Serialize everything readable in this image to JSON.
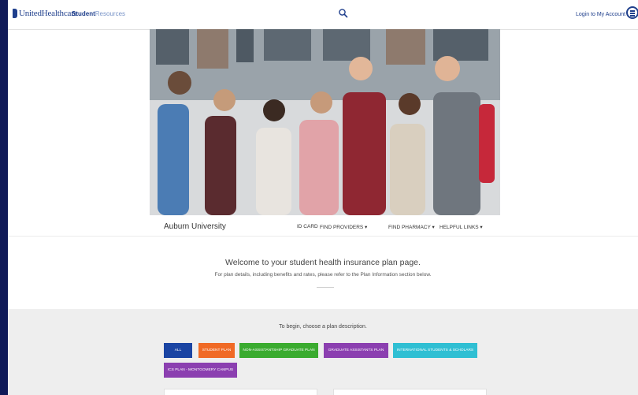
{
  "header": {
    "logo_text": "UnitedHealthcare",
    "product_part1": "Student",
    "product_part2": "Resources",
    "search_icon": "search-icon",
    "login_label": "Login to My Account",
    "menu_icon": "menu-icon"
  },
  "hero": {
    "image": "group-of-students-photo"
  },
  "subnav": {
    "university": "Auburn University",
    "links": [
      "ID CARD",
      "FIND PROVIDERS ▾",
      "FIND PHARMACY ▾",
      "HELPFUL LINKS ▾"
    ]
  },
  "welcome": {
    "title": "Welcome to your student health insurance plan page.",
    "subtitle": "For plan details, including benefits and rates, please refer to the Plan Information section below."
  },
  "plans": {
    "prompt": "To begin, choose a plan description.",
    "buttons": [
      {
        "label": "ALL",
        "color": "#1a44a3"
      },
      {
        "label": "STUDENT PLAN",
        "color": "#f06a26"
      },
      {
        "label": "NON-ASSISTANTSHIP GRADUATE PLAN",
        "color": "#3aab2f"
      },
      {
        "label": "GRADUATE ASSISTANTS PLAN",
        "color": "#8b3fb0"
      },
      {
        "label": "INTERNATIONAL STUDENTS & SCHOLARS",
        "color": "#2fbfd3"
      },
      {
        "label": "ICS PLAN - MONTGOMERY CAMPUS",
        "color": "#8b3fb0"
      }
    ]
  },
  "colors": {
    "brand": "#1f3f8c",
    "background_frame": "#101a58"
  }
}
